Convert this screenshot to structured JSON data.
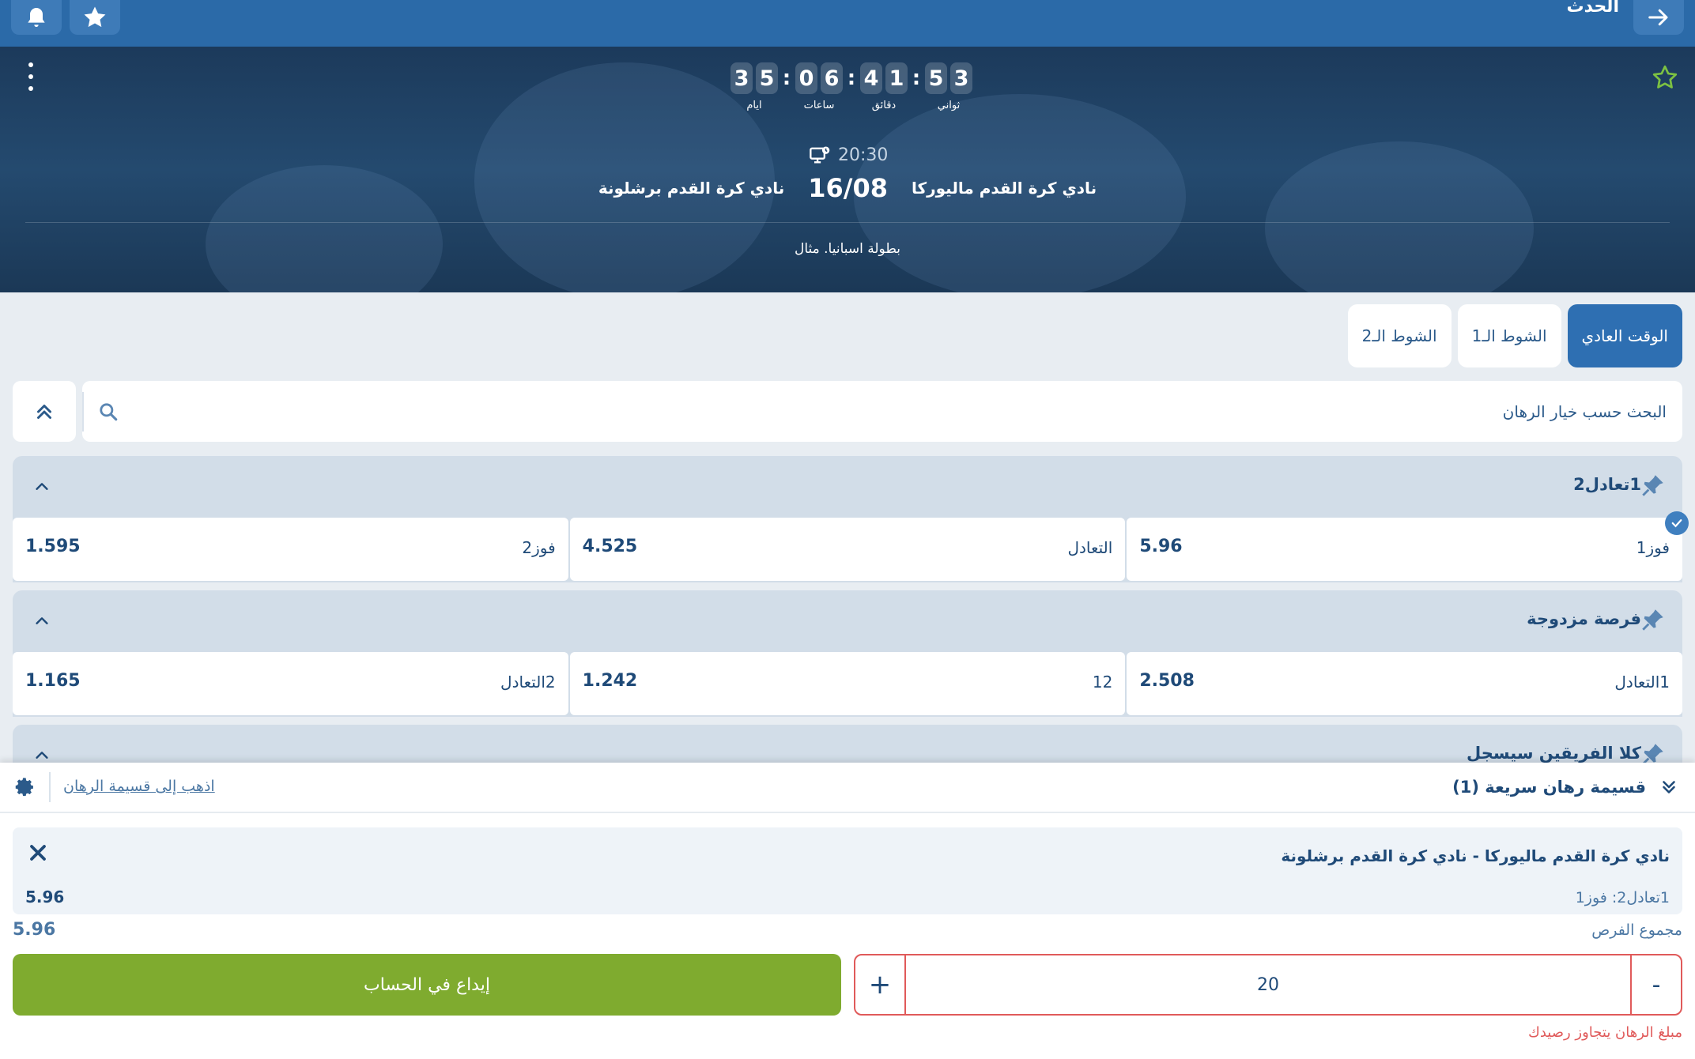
{
  "header": {
    "title": "الحدث"
  },
  "hero": {
    "countdown": [
      {
        "digits": [
          "3",
          "5"
        ],
        "label": "ايام"
      },
      {
        "digits": [
          "0",
          "6"
        ],
        "label": "ساعات"
      },
      {
        "digits": [
          "4",
          "1"
        ],
        "label": "دقائق"
      },
      {
        "digits": [
          "5",
          "3"
        ],
        "label": "ثواني"
      }
    ],
    "countdown_separator": ":",
    "kickoff_time": "20:30",
    "home_team": "نادي كرة القدم ماليوركا",
    "match_date": "16/08",
    "away_team": "نادي كرة القدم برشلونة",
    "league": "بطولة اسبانيا. مثال"
  },
  "tabs": [
    {
      "label": "الوقت العادي",
      "active": true
    },
    {
      "label": "الشوط الـ1",
      "active": false
    },
    {
      "label": "الشوط الـ2",
      "active": false
    }
  ],
  "search": {
    "placeholder": "البحث حسب خيار الرهان"
  },
  "markets": [
    {
      "title": "1تعادل2",
      "outcomes": [
        {
          "label": "فوز1",
          "odds": "5.96",
          "selected": true
        },
        {
          "label": "التعادل",
          "odds": "4.525",
          "selected": false
        },
        {
          "label": "فوز2",
          "odds": "1.595",
          "selected": false
        }
      ]
    },
    {
      "title": "فرصة مزدوجة",
      "outcomes": [
        {
          "label": "1التعادل",
          "odds": "2.508",
          "selected": false
        },
        {
          "label": "12",
          "odds": "1.242",
          "selected": false
        },
        {
          "label": "2التعادل",
          "odds": "1.165",
          "selected": false
        }
      ]
    },
    {
      "title": "كلا الفريقين سيسجل",
      "outcomes": []
    }
  ],
  "betslip": {
    "title": "قسيمة رهان سريعة (1)",
    "goto_link": "اذهب إلى قسيمة الرهان",
    "item": {
      "match": "نادي كرة القدم ماليوركا - نادي كرة القدم برشلونة",
      "pick": "1تعادل2: فوز1",
      "odds": "5.96"
    },
    "total_label": "مجموع الفرص",
    "total_odds": "5.96",
    "stake_value": "20",
    "minus_label": "-",
    "plus_label": "+",
    "deposit_label": "إيداع في الحساب",
    "error": "مبلغ الرهان يتجاوز رصيدك"
  },
  "colors": {
    "topbar": "#2b6aa8",
    "accent": "#2e6fb2",
    "deposit": "#7fab2f",
    "error": "#e05a5a",
    "favorite_star": "#7cc142"
  }
}
